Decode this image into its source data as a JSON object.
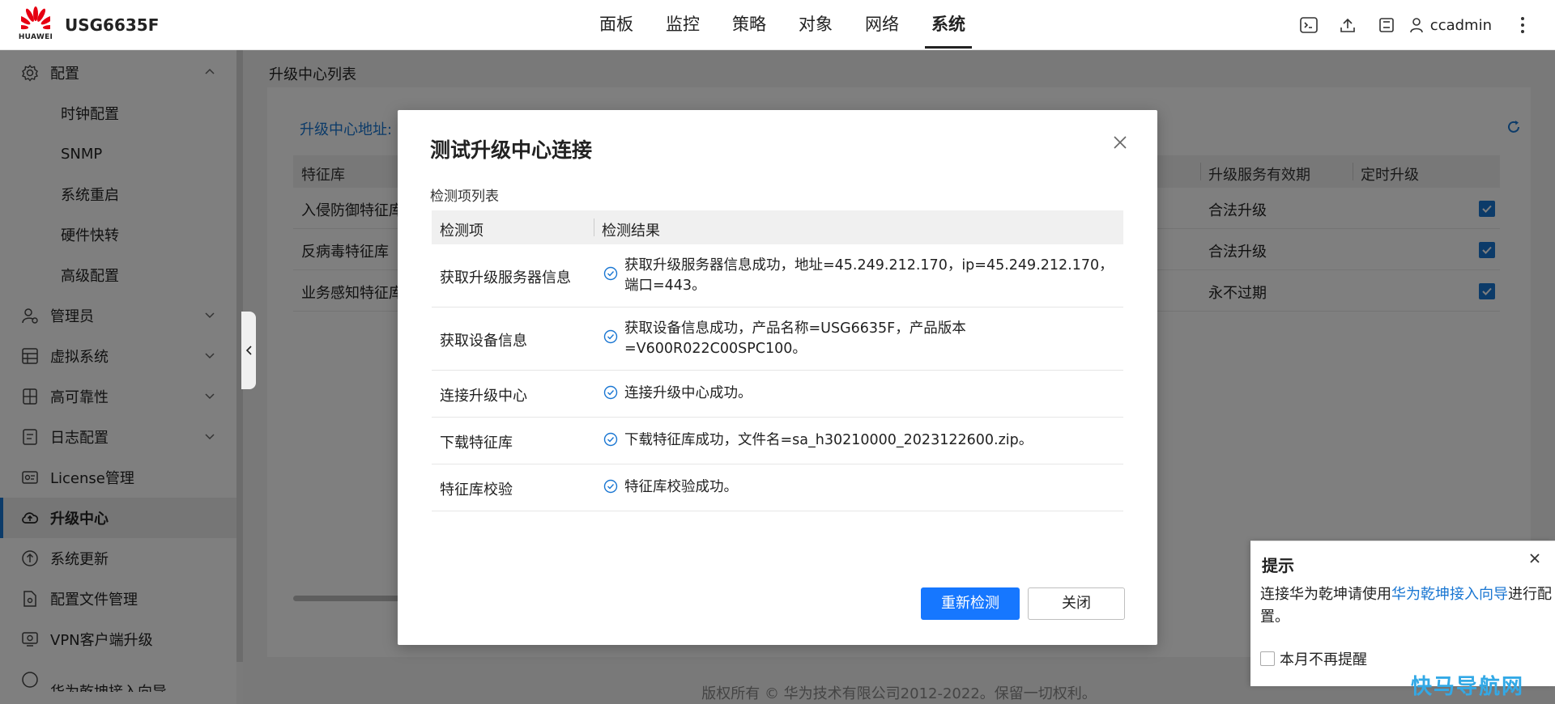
{
  "header": {
    "brand_word": "HUAWEI",
    "product": "USG6635F",
    "nav": [
      "面板",
      "监控",
      "策略",
      "对象",
      "网络",
      "系统"
    ],
    "active_nav": "系统",
    "user": "ccadmin"
  },
  "sidebar": {
    "items": [
      {
        "label": "配置",
        "icon": "gear-icon",
        "expanded": true
      },
      {
        "label": "时钟配置",
        "sub": true
      },
      {
        "label": "SNMP",
        "sub": true
      },
      {
        "label": "系统重启",
        "sub": true
      },
      {
        "label": "硬件快转",
        "sub": true
      },
      {
        "label": "高级配置",
        "sub": true
      },
      {
        "label": "管理员",
        "icon": "admin-user-icon",
        "chevron": true
      },
      {
        "label": "虚拟系统",
        "icon": "virtual-system-icon",
        "chevron": true
      },
      {
        "label": "高可靠性",
        "icon": "high-reliability-icon",
        "chevron": true
      },
      {
        "label": "日志配置",
        "icon": "log-config-icon",
        "chevron": true
      },
      {
        "label": "License管理",
        "icon": "license-icon"
      },
      {
        "label": "升级中心",
        "icon": "cloud-upgrade-icon",
        "active": true
      },
      {
        "label": "系统更新",
        "icon": "system-update-icon"
      },
      {
        "label": "配置文件管理",
        "icon": "config-file-icon"
      },
      {
        "label": "VPN客户端升级",
        "icon": "vpn-client-icon"
      },
      {
        "label": "华为乾坤接入向导",
        "icon": "guide-icon"
      }
    ]
  },
  "main": {
    "section_title": "升级中心列表",
    "address_label": "升级中心地址:",
    "columns": [
      "特征库",
      "升级服务有效期",
      "定时升级"
    ],
    "rows": [
      {
        "name": "入侵防御特征库",
        "validity": "合法升级",
        "scheduled": true
      },
      {
        "name": "反病毒特征库",
        "validity": "合法升级",
        "scheduled": true
      },
      {
        "name": "业务感知特征库",
        "validity": "永不过期",
        "scheduled": true
      }
    ],
    "footer": "版权所有 © 华为技术有限公司2012-2022。保留一切权利。"
  },
  "dialog": {
    "title": "测试升级中心连接",
    "subtitle": "检测项列表",
    "col_item": "检测项",
    "col_result": "检测结果",
    "rows": [
      {
        "item": "获取升级服务器信息",
        "result": "获取升级服务器信息成功，地址=45.249.212.170，ip=45.249.212.170，端口=443。"
      },
      {
        "item": "获取设备信息",
        "result": "获取设备信息成功，产品名称=USG6635F，产品版本=V600R022C00SPC100。"
      },
      {
        "item": "连接升级中心",
        "result": "连接升级中心成功。"
      },
      {
        "item": "下载特征库",
        "result": "下载特征库成功，文件名=sa_h30210000_2023122600.zip。"
      },
      {
        "item": "特征库校验",
        "result": "特征库校验成功。"
      }
    ],
    "btn_recheck": "重新检测",
    "btn_close": "关闭"
  },
  "tip": {
    "title": "提示",
    "text_before": "连接华为乾坤请使用",
    "link": "华为乾坤接入向导",
    "text_after": "进行配置。",
    "checkbox_label": "本月不再提醒"
  },
  "watermark": "快马导航网",
  "colors": {
    "accent": "#1976d2",
    "primary_button": "#1677ff",
    "brand_red": "#e60012"
  }
}
